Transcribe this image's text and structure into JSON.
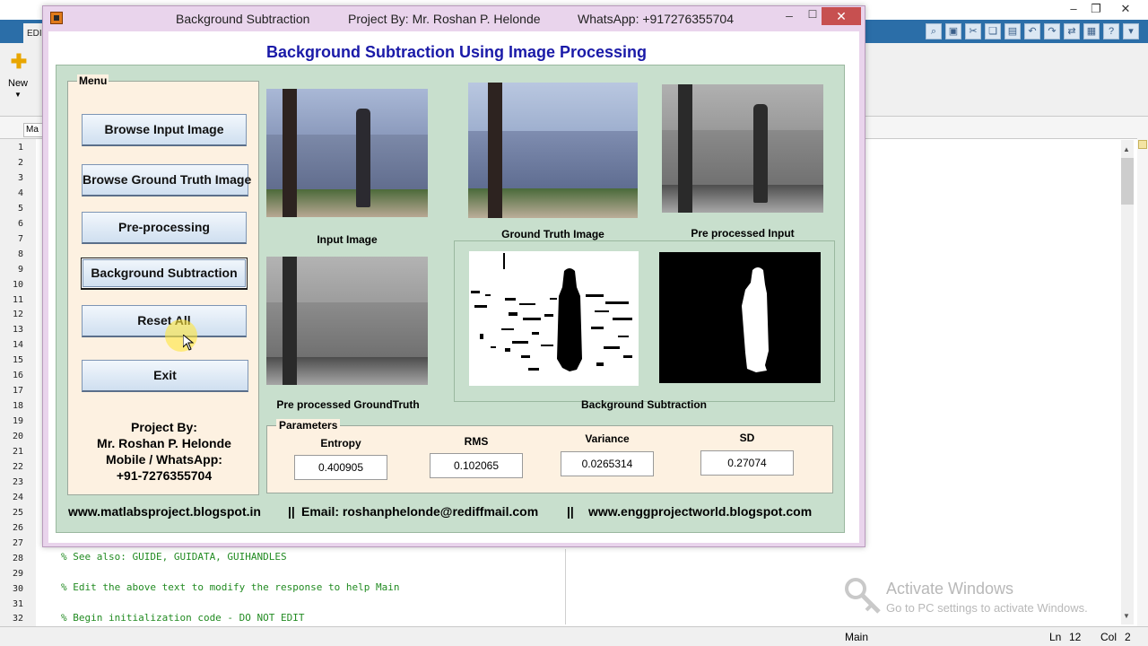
{
  "matlab": {
    "editor_tab": "EDI",
    "new_label": "New",
    "doc_tab": "Ma",
    "line_numbers": [
      "1",
      "2",
      "3",
      "4",
      "5",
      "6",
      "7",
      "8",
      "9",
      "10",
      "11",
      "12",
      "13",
      "14",
      "15",
      "16",
      "17",
      "18",
      "19",
      "20",
      "21",
      "22",
      "23",
      "24",
      "25",
      "26",
      "27",
      "28",
      "29",
      "30",
      "31",
      "32"
    ],
    "code": {
      "line28": "% See also: GUIDE, GUIDATA, GUIHANDLES",
      "line30": "% Edit the above text to modify the response to help Main",
      "line32": "% Begin initialization code - DO NOT EDIT"
    },
    "status": {
      "file": "Main",
      "ln_label": "Ln",
      "ln": "12",
      "col_label": "Col",
      "col": "2"
    },
    "activate": {
      "title": "Activate Windows",
      "subtitle": "Go to PC settings to activate Windows."
    }
  },
  "gui": {
    "title": "Background Subtraction",
    "project_by": "Project By: Mr. Roshan P. Helonde",
    "whatsapp": "WhatsApp: +917276355704",
    "heading": "Background Subtraction Using Image Processing",
    "menu": {
      "label": "Menu",
      "buttons": {
        "browse_input": "Browse Input Image",
        "browse_gt": "Browse Ground Truth Image",
        "preprocessing": "Pre-processing",
        "bg_subtraction": "Background Subtraction",
        "reset": "Reset All",
        "exit": "Exit"
      },
      "credits": [
        "Project By:",
        "Mr. Roshan P. Helonde",
        "Mobile / WhatsApp:",
        "+91-7276355704"
      ]
    },
    "images": {
      "input": "Input Image",
      "ground_truth": "Ground Truth Image",
      "preprocessed_input": "Pre processed Input",
      "preprocessed_gt": "Pre processed GroundTruth",
      "bg_subtraction": "Background Subtraction"
    },
    "parameters": {
      "label": "Parameters",
      "entropy_label": "Entropy",
      "entropy": "0.400905",
      "rms_label": "RMS",
      "rms": "0.102065",
      "variance_label": "Variance",
      "variance": "0.0265314",
      "sd_label": "SD",
      "sd": "0.27074"
    },
    "footer": {
      "site1": "www.matlabsproject.blogspot.in",
      "sep1": "||",
      "email": "Email: roshanphelonde@rediffmail.com",
      "sep2": "||",
      "site2": "www.enggprojectworld.blogspot.com"
    }
  },
  "colors": {
    "heading": "#1a1aa8",
    "panel_green": "#c8dfcd",
    "menu_bg": "#fdf1e1",
    "window_border": "#e9d4ec",
    "close_red": "#c75050",
    "code_comment": "#228b22"
  }
}
